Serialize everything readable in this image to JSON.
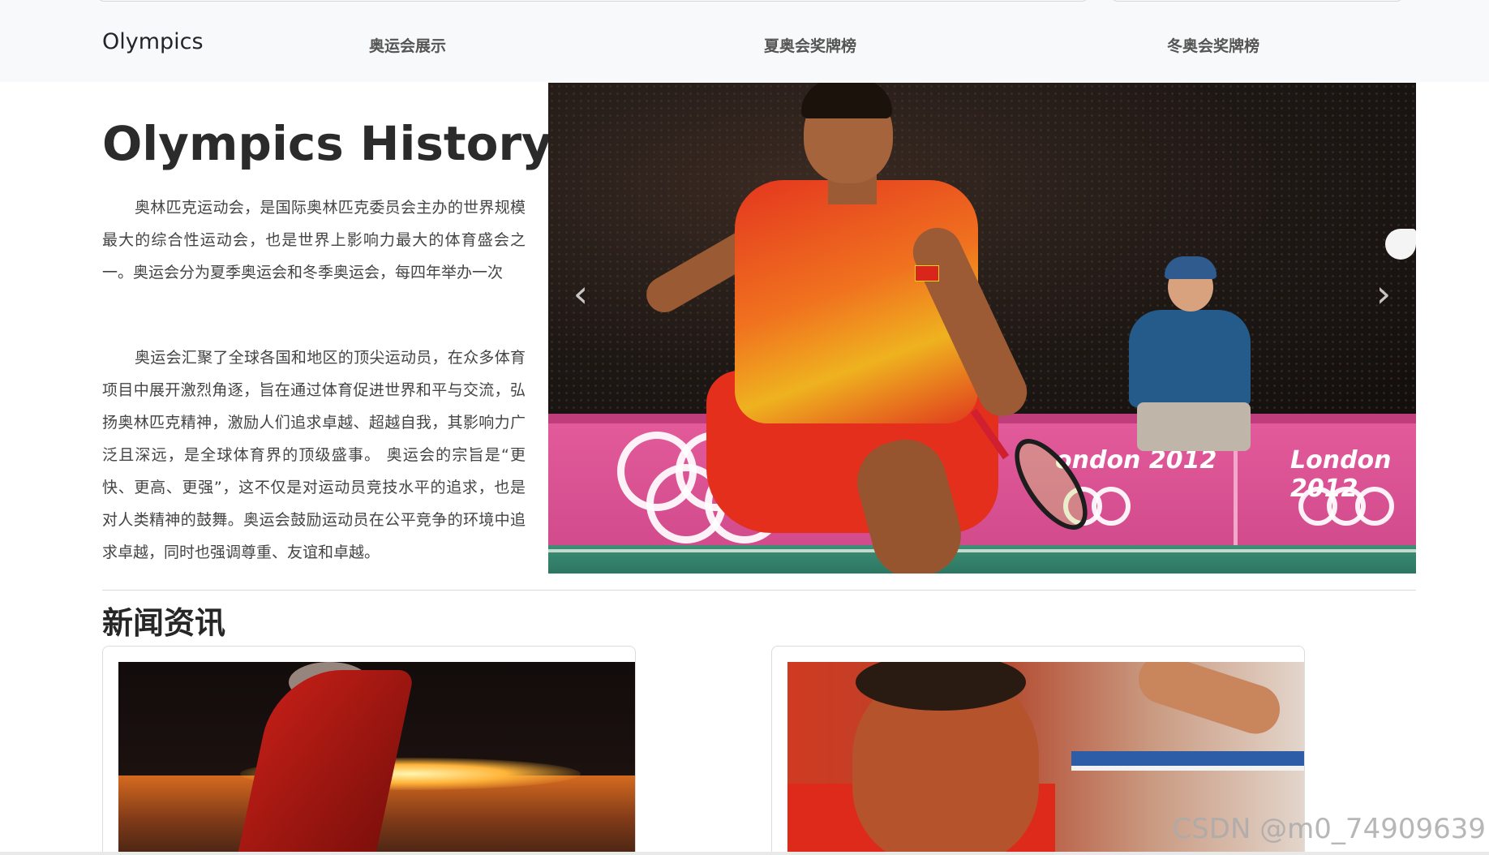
{
  "nav": {
    "brand": "Olympics",
    "links": [
      {
        "label": "奥运会展示"
      },
      {
        "label": "夏奥会奖牌榜"
      },
      {
        "label": "冬奥会奖牌榜"
      }
    ]
  },
  "hero": {
    "title": "Olympics History",
    "paragraphs": [
      "奥林匹克运动会，是国际奥林匹克委员会主办的世界规模最大的综合性运动会，也是世界上影响力最大的体育盛会之一。奥运会分为夏季奥运会和冬季奥运会，每四年举办一次",
      "奥运会汇聚了全球各国和地区的顶尖运动员，在众多体育项目中展开激烈角逐，旨在通过体育促进世界和平与交流，弘扬奥林匹克精神，激励人们追求卓越、超越自我，其影响力广泛且深远，是全球体育界的顶级盛事。 奥运会的宗旨是“更快、更高、更强”，这不仅是对运动员竞技水平的追求，也是对人类精神的鼓舞。奥运会鼓励运动员在公平竞争的环境中追求卓越，同时也强调尊重、友谊和卓越。"
    ]
  },
  "carousel": {
    "board_text": [
      "ondon 2012",
      "London 2012"
    ],
    "prev_icon": "chevron-left-icon",
    "next_icon": "chevron-right-icon",
    "prev_glyph": "‹",
    "next_glyph": "›"
  },
  "news": {
    "title": "新闻资讯",
    "cards": [
      {
        "image": "olympic-cauldron-photo"
      },
      {
        "image": "hurdler-photo"
      }
    ]
  },
  "watermark": "CSDN @m0_74909639"
}
